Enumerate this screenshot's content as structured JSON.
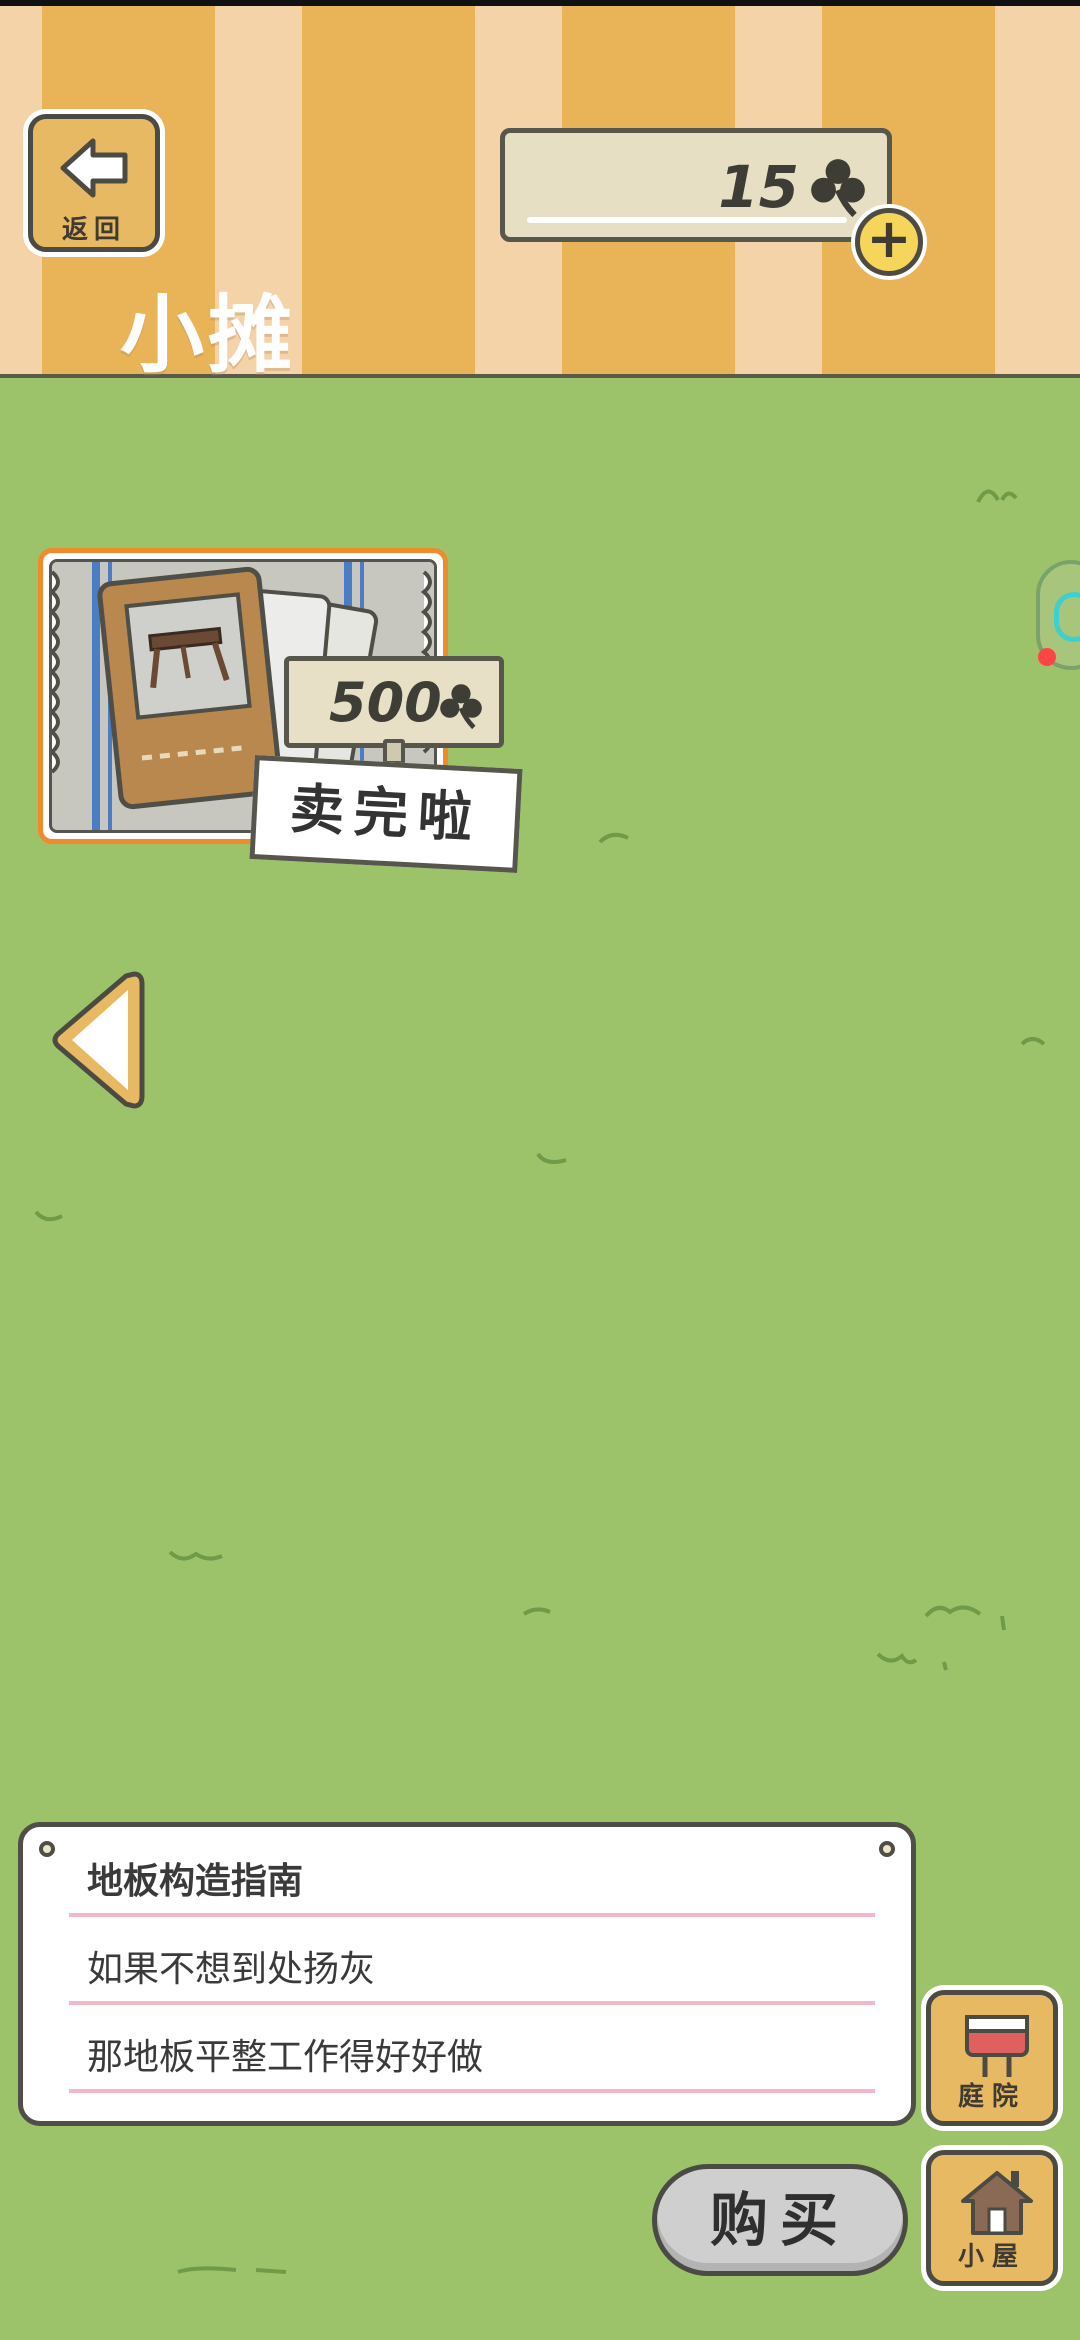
{
  "header": {
    "back_label": "返回",
    "title": "小摊",
    "clover_count": "15"
  },
  "shop": {
    "item_price": "500",
    "sold_out_label": "卖完啦"
  },
  "description": {
    "item_name": "地板构造指南",
    "line1": "如果不想到处扬灰",
    "line2": "那地板平整工作得好好做"
  },
  "nav": {
    "yard_label": "庭院",
    "house_label": "小屋",
    "buy_label": "购买"
  },
  "colors": {
    "grass": "#9dc36a",
    "stripe_light": "#f4d3a9",
    "stripe_dark": "#e9b458",
    "button_wood": "#e8b963",
    "outline": "#4b4a43",
    "card_border": "#f08a2a",
    "panel_line": "#f1b9c8"
  },
  "icons": [
    "back-arrow-icon",
    "clover-icon",
    "plus-icon",
    "left-arrow-icon",
    "mailbox-icon",
    "house-icon",
    "table-icon"
  ]
}
